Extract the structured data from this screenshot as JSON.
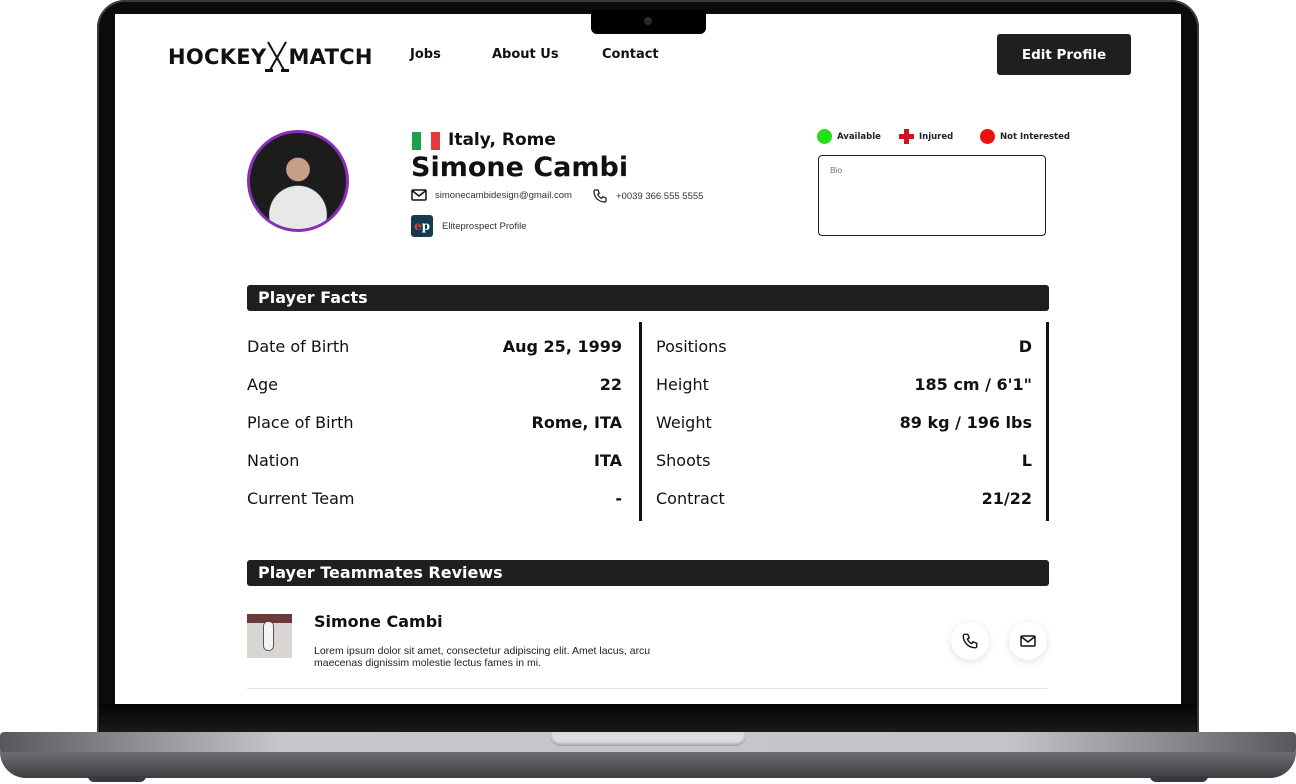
{
  "header": {
    "logo_left": "HOCKEY",
    "logo_right": "MATCH",
    "nav": [
      "Jobs",
      "About Us",
      "Contact"
    ],
    "edit_profile_label": "Edit Profile"
  },
  "profile": {
    "location": "Italy, Rome",
    "flag_colors": [
      "#1fa04a",
      "#ffffff",
      "#e0393e"
    ],
    "name": "Simone Cambi",
    "email": "simonecambidesign@gmail.com",
    "phone": "+0039 366 555 5555",
    "eliteprospects_badge": "ep",
    "eliteprospects_label": "Eliteprospect Profile"
  },
  "status_legend": [
    {
      "label": "Available",
      "color": "#22e01a",
      "icon": "circle"
    },
    {
      "label": "Injured",
      "color": "#d0141b",
      "icon": "cross"
    },
    {
      "label": "Not Interested",
      "color": "#f00f0f",
      "icon": "circle"
    }
  ],
  "bio": {
    "placeholder": "Bio"
  },
  "player_facts": {
    "title": "Player Facts",
    "left": [
      {
        "label": "Date of Birth",
        "value": "Aug 25, 1999"
      },
      {
        "label": "Age",
        "value": "22"
      },
      {
        "label": "Place of Birth",
        "value": "Rome, ITA"
      },
      {
        "label": "Nation",
        "value": "ITA"
      },
      {
        "label": "Current Team",
        "value": "-"
      }
    ],
    "right": [
      {
        "label": "Positions",
        "value": "D"
      },
      {
        "label": "Height",
        "value": "185 cm / 6'1\""
      },
      {
        "label": "Weight",
        "value": "89 kg / 196 lbs"
      },
      {
        "label": "Shoots",
        "value": "L"
      },
      {
        "label": "Contract",
        "value": "21/22"
      }
    ]
  },
  "reviews": {
    "title": "Player Teammates Reviews",
    "items": [
      {
        "name": "Simone Cambi",
        "text": "Lorem ipsum dolor sit amet, consectetur adipiscing elit. Amet lacus, arcu maecenas dignissim molestie lectus fames in mi."
      }
    ]
  }
}
